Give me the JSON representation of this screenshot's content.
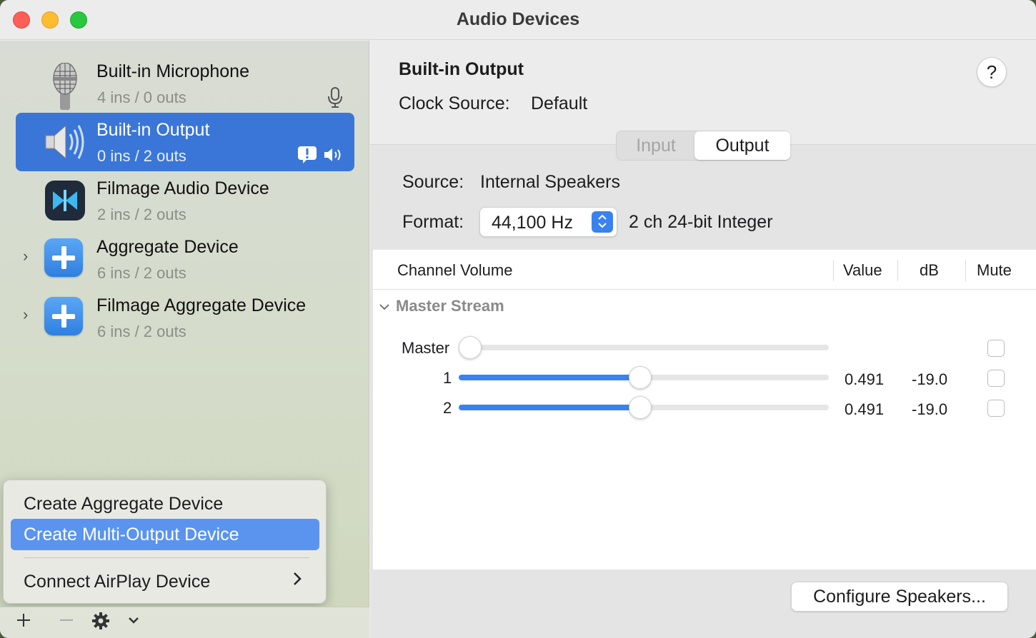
{
  "window": {
    "title": "Audio Devices"
  },
  "devices": [
    {
      "name": "Built-in Microphone",
      "io": "4 ins / 0 outs",
      "icon": "microphone-icon",
      "selected": false
    },
    {
      "name": "Built-in Output",
      "io": "0 ins / 2 outs",
      "icon": "speaker-icon",
      "selected": true
    },
    {
      "name": "Filmage Audio Device",
      "io": "2 ins / 2 outs",
      "icon": "filmage-icon",
      "selected": false
    },
    {
      "name": "Aggregate Device",
      "io": "6 ins / 2 outs",
      "icon": "aggregate-icon",
      "selected": false
    },
    {
      "name": "Filmage Aggregate Device",
      "io": "6 ins / 2 outs",
      "icon": "aggregate-icon",
      "selected": false
    }
  ],
  "menu": {
    "items": [
      {
        "label": "Create Aggregate Device",
        "highlighted": false
      },
      {
        "label": "Create Multi-Output Device",
        "highlighted": true
      },
      {
        "label": "Connect AirPlay Device",
        "submenu": true
      }
    ]
  },
  "detail": {
    "title": "Built-in Output",
    "clock_label": "Clock Source:",
    "clock_value": "Default",
    "help": "?",
    "tabs": [
      "Input",
      "Output"
    ],
    "active_tab": "Output",
    "source_label": "Source:",
    "source_value": "Internal Speakers",
    "format_label": "Format:",
    "format_value": "44,100 Hz",
    "format_extra": "2 ch 24-bit Integer",
    "table": {
      "headers": [
        "Channel Volume",
        "Value",
        "dB",
        "Mute"
      ],
      "group": "Master Stream",
      "rows": [
        {
          "label": "Master",
          "level": 0.0,
          "value": "",
          "db": "",
          "muted": false
        },
        {
          "label": "1",
          "level": 0.491,
          "value": "0.491",
          "db": "-19.0",
          "muted": false
        },
        {
          "label": "2",
          "level": 0.491,
          "value": "0.491",
          "db": "-19.0",
          "muted": false
        }
      ]
    },
    "configure_button": "Configure Speakers..."
  },
  "colors": {
    "accent": "#3a82f0",
    "selection": "#3a76d8",
    "menu_highlight": "#5b94ee"
  }
}
